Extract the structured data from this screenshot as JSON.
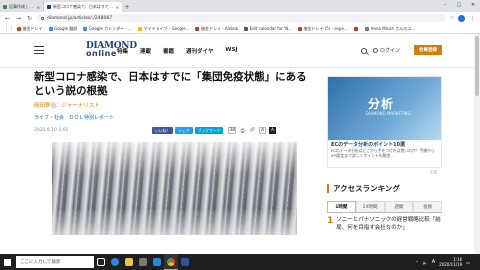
{
  "browser": {
    "tabs": [
      {
        "label": "記事作成 | Livedoor Blog",
        "color": "#3d8c40",
        "active": false
      },
      {
        "label": "新型コロナ感染で、日本はすでに「集団免",
        "color": "#1f3f7a",
        "active": true
      }
    ],
    "new_tab": "+",
    "window_controls": [
      "–",
      "□",
      "✕"
    ],
    "url": "diamond.jp/articles/-/248087",
    "bookmarks": [
      {
        "label": "借金ドレイ",
        "color": "#c0392b"
      },
      {
        "label": "Google 翻訳",
        "color": "#4285f4"
      },
      {
        "label": "Google カレンダー - ...",
        "color": "#4285f4"
      },
      {
        "label": "マイドライブ - Google...",
        "color": "#f4b400"
      },
      {
        "label": "借金ドレイ - Airbnb",
        "color": "#c0392b"
      },
      {
        "label": "Edit calendar for 'N...",
        "color": "#555555"
      },
      {
        "label": "借金ドレイ (5) - espe...",
        "color": "#c0392b"
      },
      {
        "label": "",
        "color": "#c0392b"
      },
      {
        "label": "Anna Micah さんのコ...",
        "color": "#777777"
      }
    ]
  },
  "site": {
    "logo_line1": "DIAMOND",
    "logo_line2": "online",
    "nav": [
      "特集",
      "連載",
      "書籍",
      "週刊ダイヤ",
      "WSJ"
    ],
    "login": "ログイン",
    "member_button": "会員登録",
    "brand_color": "#d67a0a"
  },
  "article": {
    "headline": "新型コロナ感染で、日本はすでに「集団免疫状態」にあるという説の根拠",
    "author": "岡田幹治：ジャーナリスト",
    "categories": [
      "ライフ・社会",
      "ＤＯＬ特別レポート"
    ],
    "date": "2020.9.10 5:05",
    "share": {
      "facebook": "いいね！",
      "twitter": "シェア",
      "hatena": "ブックマーク",
      "hatena_count": "38"
    },
    "text_size": "A"
  },
  "sidebar": {
    "ad_image_text": "分析",
    "ad_image_sub": "DIAMOND MARKETING",
    "ad_title": "ECのデータ分析のポイント10選",
    "ad_desc": "ECのデータ分析はどこから手をつければ良いのか？手順からKPI設定まで詳しくポイントを解説",
    "ad_label": "広告",
    "ranking_title": "アクセスランキング",
    "ranking_tabs": [
      "1時間",
      "24時間",
      "週間",
      "会員"
    ],
    "ranking_items": [
      {
        "rank": "1",
        "text": "ソニーとパナソニックの経営戦略比較「結局、何を目指す会社なのか」"
      }
    ]
  },
  "taskbar": {
    "search_placeholder": "ここに入力して検索",
    "apps": [
      {
        "name": "task-view",
        "color": "#ffffff"
      },
      {
        "name": "edge",
        "color": "#2b88d8"
      },
      {
        "name": "explorer",
        "color": "#f0c040"
      },
      {
        "name": "store",
        "color": "#7a7a7a"
      },
      {
        "name": "mail",
        "color": "#2b88d8"
      },
      {
        "name": "chrome",
        "color": "#34a853"
      },
      {
        "name": "word",
        "color": "#2b579a"
      }
    ],
    "lang": "A",
    "time": "1:16",
    "date": "2020/11/19"
  }
}
